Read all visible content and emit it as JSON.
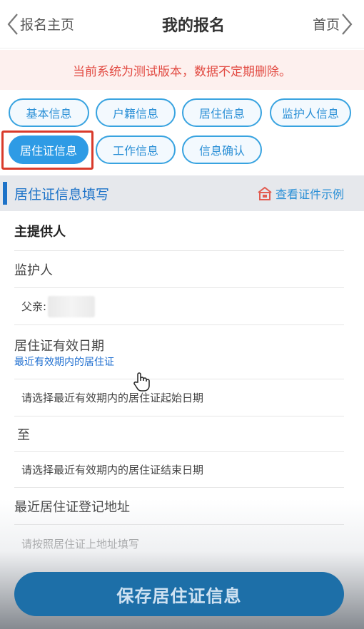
{
  "header": {
    "back_label": "报名主页",
    "title": "我的报名",
    "home_label": "首页"
  },
  "notice": {
    "text": "当前系统为测试版本，数据不定期删除。"
  },
  "tabs": [
    {
      "label": "基本信息",
      "active": false
    },
    {
      "label": "户籍信息",
      "active": false
    },
    {
      "label": "居住信息",
      "active": false
    },
    {
      "label": "监护人信息",
      "active": false
    },
    {
      "label": "居住证信息",
      "active": true
    },
    {
      "label": "工作信息",
      "active": false
    },
    {
      "label": "信息确认",
      "active": false
    }
  ],
  "section": {
    "title": "居住证信息填写",
    "sample_link": "查看证件示例"
  },
  "form": {
    "provider_label": "主提供人",
    "guardian_label": "监护人",
    "guardian_value": "父亲:",
    "validity_label": "居住证有效日期",
    "validity_hint": "最近有效期内的居住证",
    "start_placeholder": "请选择最近有效期内的居住证起始日期",
    "to_label": "至",
    "end_placeholder": "请选择最近有效期内的居住证结束日期",
    "address_label": "最近居住证登记地址",
    "address_placeholder": "请按照居住证上地址填写"
  },
  "footer": {
    "save_label": "保存居住证信息"
  },
  "colors": {
    "accent": "#2e9be5",
    "brand_blue": "#1e73c8",
    "notice_text": "#e24b43",
    "highlight_border": "#d93a2b"
  }
}
